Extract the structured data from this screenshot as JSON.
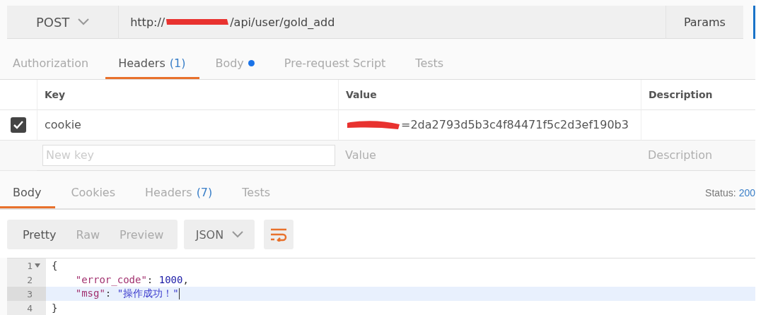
{
  "request": {
    "method": "POST",
    "url_prefix": "http://",
    "url_path": "/api/user/gold_add",
    "params_button": "Params"
  },
  "request_tabs": [
    {
      "label": "Authorization",
      "selected": false
    },
    {
      "label": "Headers",
      "count": "(1)",
      "selected": true
    },
    {
      "label": "Body",
      "dot": true,
      "selected": false
    },
    {
      "label": "Pre-request Script",
      "selected": false
    },
    {
      "label": "Tests",
      "selected": false
    }
  ],
  "headers_table": {
    "columns": [
      "Key",
      "Value",
      "Description"
    ],
    "rows": [
      {
        "checked": true,
        "key": "cookie",
        "value": "=2da2793d5b3c4f84471f5c2d3ef190b3",
        "value_redacted": true
      }
    ],
    "new_row": {
      "key_placeholder": "New key",
      "value_placeholder": "Value",
      "description_placeholder": "Description"
    }
  },
  "response_tabs": [
    {
      "label": "Body",
      "selected": true
    },
    {
      "label": "Cookies",
      "selected": false
    },
    {
      "label": "Headers",
      "count": "(7)",
      "selected": false
    },
    {
      "label": "Tests",
      "selected": false
    }
  ],
  "status": {
    "label": "Status:",
    "value": "200"
  },
  "view_modes": [
    {
      "label": "Pretty",
      "selected": true
    },
    {
      "label": "Raw",
      "selected": false
    },
    {
      "label": "Preview",
      "selected": false
    }
  ],
  "format": "JSON",
  "code_lines": [
    {
      "number": "1",
      "foldable": true,
      "active": false,
      "tokens": [
        {
          "kind": "punct",
          "text": "{"
        }
      ]
    },
    {
      "number": "2",
      "foldable": false,
      "active": false,
      "tokens": [
        {
          "kind": "key",
          "text": "    \"error_code\""
        },
        {
          "kind": "punct",
          "text": ": "
        },
        {
          "kind": "number",
          "text": "1000"
        },
        {
          "kind": "punct",
          "text": ","
        }
      ]
    },
    {
      "number": "3",
      "foldable": false,
      "active": true,
      "tokens": [
        {
          "kind": "key",
          "text": "    \"msg\""
        },
        {
          "kind": "punct",
          "text": ": "
        },
        {
          "kind": "string",
          "text": "\"操作成功！\""
        }
      ]
    },
    {
      "number": "4",
      "foldable": false,
      "active": false,
      "tokens": [
        {
          "kind": "punct",
          "text": "}"
        }
      ]
    }
  ]
}
